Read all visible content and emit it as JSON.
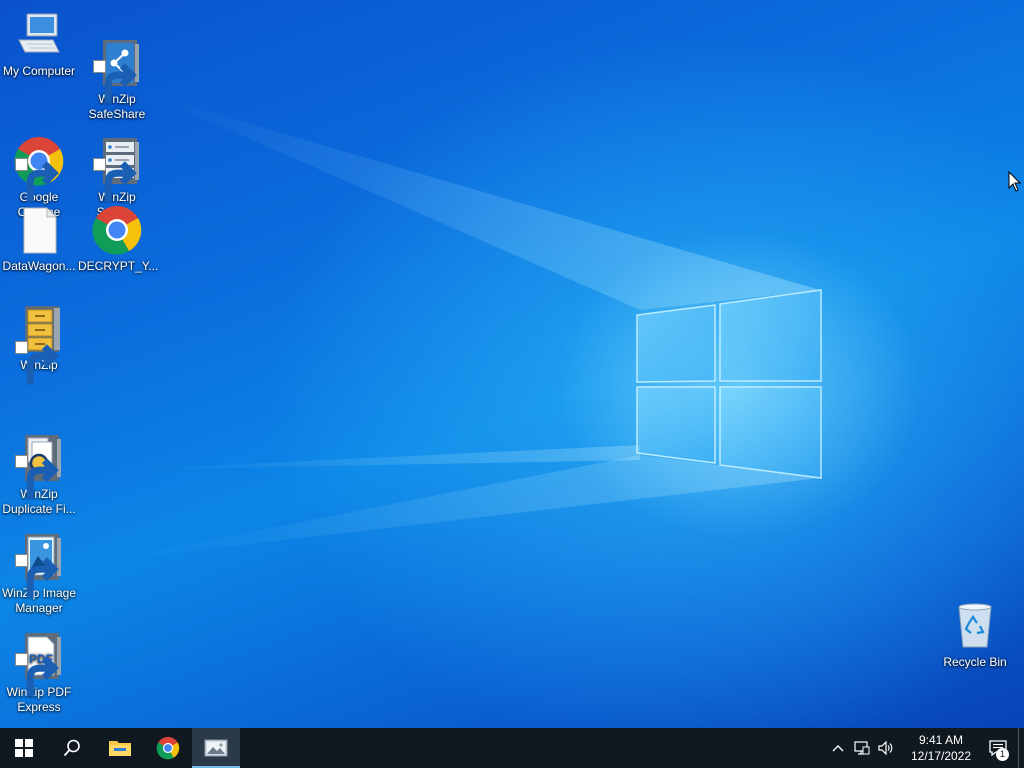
{
  "desktop": {
    "icons": [
      {
        "id": "my-computer",
        "label": "My Computer",
        "icon": "computer-icon",
        "shortcut": false
      },
      {
        "id": "winzip-safeshare",
        "label": "WinZip\nSafeShare",
        "icon": "winzip-safeshare-icon",
        "shortcut": true
      },
      {
        "id": "google-chrome",
        "label": "Google\nChrome",
        "icon": "chrome-icon",
        "shortcut": true
      },
      {
        "id": "winzip-secure",
        "label": "WinZip\nSecur...",
        "icon": "winzip-secure-backup-icon",
        "shortcut": true
      },
      {
        "id": "datawagon",
        "label": "DataWagon...",
        "icon": "blank-file-icon",
        "shortcut": false
      },
      {
        "id": "decrypt",
        "label": "DECRYPT_Y...",
        "icon": "chrome-icon",
        "shortcut": false
      },
      {
        "id": "winzip",
        "label": "WinZip",
        "icon": "winzip-icon",
        "shortcut": true
      },
      {
        "id": "winzip-duplicate",
        "label": "WinZip\nDuplicate Fi...",
        "icon": "winzip-duplicate-finder-icon",
        "shortcut": true
      },
      {
        "id": "winzip-image-manager",
        "label": "WinZip Image\nManager",
        "icon": "winzip-image-manager-icon",
        "shortcut": true
      },
      {
        "id": "winzip-pdf-express",
        "label": "WinZip PDF\nExpress",
        "icon": "winzip-pdf-express-icon",
        "shortcut": true
      },
      {
        "id": "recycle-bin",
        "label": "Recycle Bin",
        "icon": "recycle-bin-icon",
        "shortcut": false
      }
    ],
    "wallpaper": "windows-10-hero"
  },
  "taskbar": {
    "buttons": [
      {
        "name": "start-button",
        "icon": "windows-start-icon"
      },
      {
        "name": "search-button",
        "icon": "search-icon"
      },
      {
        "name": "file-explorer-button",
        "icon": "folder-icon"
      },
      {
        "name": "chrome-taskbar-button",
        "icon": "chrome-icon"
      },
      {
        "name": "winzip-image-manager-taskbar-button",
        "icon": "image-manager-icon",
        "active": true
      }
    ],
    "tray": {
      "icons": [
        "chevron-up-icon",
        "network-icon",
        "volume-icon"
      ],
      "time": "9:41 AM",
      "date": "12/17/2022",
      "notification_count": "1"
    }
  },
  "colors": {
    "taskbar": "#101820",
    "accent": "#76b9ed",
    "wallpaper_blue": "#0b6fde"
  }
}
